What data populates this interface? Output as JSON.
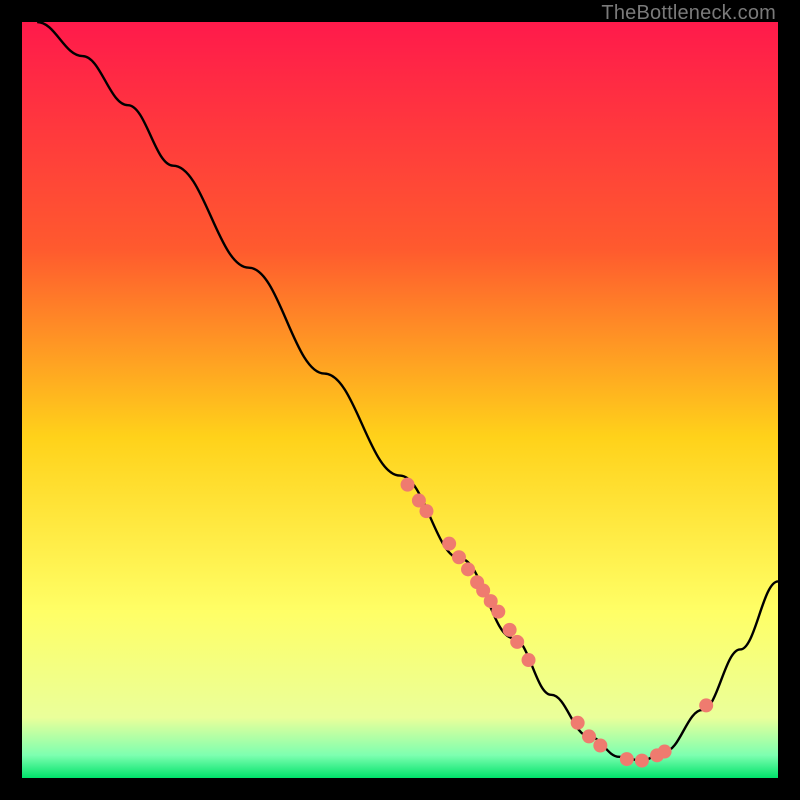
{
  "attribution": "TheBottleneck.com",
  "chart_data": {
    "type": "line",
    "title": "",
    "xlabel": "",
    "ylabel": "",
    "xlim": [
      0,
      100
    ],
    "ylim": [
      0,
      100
    ],
    "gradient_stops": [
      {
        "offset": 0,
        "color": "#ff1a4b"
      },
      {
        "offset": 30,
        "color": "#ff5a2e"
      },
      {
        "offset": 55,
        "color": "#ffd21a"
      },
      {
        "offset": 78,
        "color": "#ffff66"
      },
      {
        "offset": 92,
        "color": "#eaff9a"
      },
      {
        "offset": 97,
        "color": "#7dffb0"
      },
      {
        "offset": 100,
        "color": "#00e26a"
      }
    ],
    "curve": [
      {
        "x": 2.0,
        "y": 100.0
      },
      {
        "x": 8.0,
        "y": 95.5
      },
      {
        "x": 14.0,
        "y": 89.0
      },
      {
        "x": 20.0,
        "y": 81.0
      },
      {
        "x": 30.0,
        "y": 67.5
      },
      {
        "x": 40.0,
        "y": 53.5
      },
      {
        "x": 50.0,
        "y": 40.0
      },
      {
        "x": 58.0,
        "y": 29.0
      },
      {
        "x": 65.0,
        "y": 18.5
      },
      {
        "x": 70.0,
        "y": 11.0
      },
      {
        "x": 75.0,
        "y": 5.5
      },
      {
        "x": 79.0,
        "y": 2.8
      },
      {
        "x": 82.0,
        "y": 2.3
      },
      {
        "x": 85.0,
        "y": 3.5
      },
      {
        "x": 90.0,
        "y": 9.0
      },
      {
        "x": 95.0,
        "y": 17.0
      },
      {
        "x": 100.0,
        "y": 26.0
      }
    ],
    "points": [
      {
        "x": 51.0,
        "y": 38.8
      },
      {
        "x": 52.5,
        "y": 36.7
      },
      {
        "x": 53.5,
        "y": 35.3
      },
      {
        "x": 56.5,
        "y": 31.0
      },
      {
        "x": 57.8,
        "y": 29.2
      },
      {
        "x": 59.0,
        "y": 27.6
      },
      {
        "x": 60.2,
        "y": 25.9
      },
      {
        "x": 61.0,
        "y": 24.8
      },
      {
        "x": 62.0,
        "y": 23.4
      },
      {
        "x": 63.0,
        "y": 22.0
      },
      {
        "x": 64.5,
        "y": 19.6
      },
      {
        "x": 65.5,
        "y": 18.0
      },
      {
        "x": 67.0,
        "y": 15.6
      },
      {
        "x": 73.5,
        "y": 7.3
      },
      {
        "x": 75.0,
        "y": 5.5
      },
      {
        "x": 76.5,
        "y": 4.3
      },
      {
        "x": 80.0,
        "y": 2.5
      },
      {
        "x": 82.0,
        "y": 2.3
      },
      {
        "x": 84.0,
        "y": 3.0
      },
      {
        "x": 85.0,
        "y": 3.5
      },
      {
        "x": 90.5,
        "y": 9.6
      }
    ],
    "point_style": {
      "fill": "#ef7b6f",
      "radius": 7
    }
  }
}
